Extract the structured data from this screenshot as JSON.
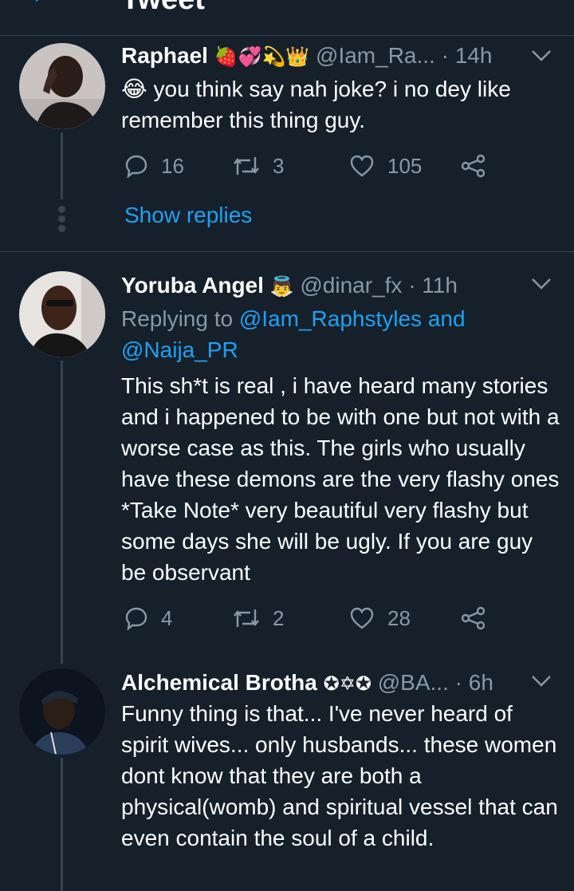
{
  "header": {
    "title": "Tweet"
  },
  "colors": {
    "background": "#15202b",
    "accent": "#1da1f2",
    "muted": "#8899a6",
    "divider": "#38444d"
  },
  "tweets": [
    {
      "name": "Raphael",
      "emojis": "🍓💞💫👑",
      "handle": "@Iam_Ra...",
      "time": "· 14h",
      "lead_emoji": "😂",
      "text": "you think say nah joke? i no dey like remember this thing guy.",
      "replies": "16",
      "retweets": "3",
      "likes": "105",
      "show_replies": "Show replies"
    },
    {
      "name": "Yoruba Angel",
      "emojis": "👼",
      "handle": "@dinar_fx",
      "time": "· 11h",
      "replying_prefix": "Replying to",
      "reply_user_1": "@Iam_Raphstyles",
      "reply_and": "and",
      "reply_user_2": "@Naija_PR",
      "text": "This sh*t is real , i have heard many stories and i happened to be with one but not with a worse case as this. The girls who usually have these demons are the very flashy ones *Take Note* very beautiful very flashy but some days she will be ugly. If you are guy be observant",
      "replies": "4",
      "retweets": "2",
      "likes": "28"
    },
    {
      "name": "Alchemical Brotha",
      "emojis": "✪✡✪",
      "handle": "@BA...",
      "time": "· 6h",
      "text": "Funny thing is that... I've never heard of spirit wives... only husbands...  these women dont know that they are both a physical(womb) and spiritual vessel that can even contain the soul of a child."
    }
  ]
}
